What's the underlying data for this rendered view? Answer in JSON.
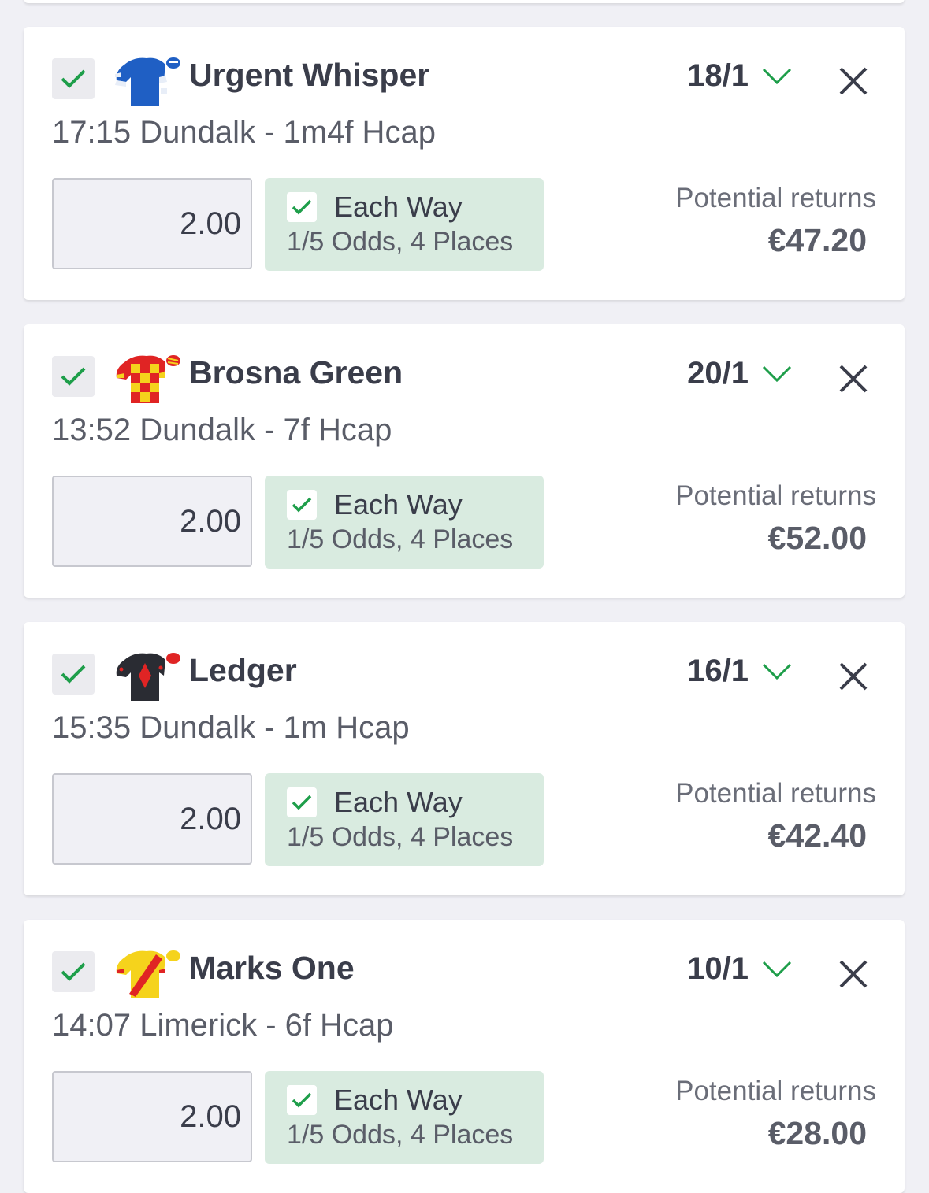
{
  "colors": {
    "accent_green": "#1e9e4a",
    "each_way_bg": "#d9ebe0",
    "page_bg": "#f0f0f5",
    "card_bg": "#ffffff",
    "text_dark": "#3a3d4a"
  },
  "icons": {
    "checkbox": "check-icon",
    "odds_dropdown": "chevron-down-icon",
    "remove": "close-icon"
  },
  "bets": [
    {
      "horse": "Urgent Whisper",
      "race": "17:15 Dundalk - 1m4f Hcap",
      "odds": "18/1",
      "stake": "2.00",
      "each_way_label": "Each Way",
      "each_way_terms": "1/5 Odds, 4 Places",
      "returns_label": "Potential returns",
      "returns_value": "€47.20",
      "silks": "royal-blue-silks"
    },
    {
      "horse": "Brosna Green",
      "race": "13:52 Dundalk - 7f Hcap",
      "odds": "20/1",
      "stake": "2.00",
      "each_way_label": "Each Way",
      "each_way_terms": "1/5 Odds, 4 Places",
      "returns_label": "Potential returns",
      "returns_value": "€52.00",
      "silks": "red-yellow-check-silks"
    },
    {
      "horse": "Ledger",
      "race": "15:35 Dundalk - 1m Hcap",
      "odds": "16/1",
      "stake": "2.00",
      "each_way_label": "Each Way",
      "each_way_terms": "1/5 Odds, 4 Places",
      "returns_label": "Potential returns",
      "returns_value": "€42.40",
      "silks": "black-red-diamond-silks"
    },
    {
      "horse": "Marks One",
      "race": "14:07 Limerick - 6f Hcap",
      "odds": "10/1",
      "stake": "2.00",
      "each_way_label": "Each Way",
      "each_way_terms": "1/5 Odds, 4 Places",
      "returns_label": "Potential returns",
      "returns_value": "€28.00",
      "silks": "yellow-red-sash-silks"
    }
  ]
}
